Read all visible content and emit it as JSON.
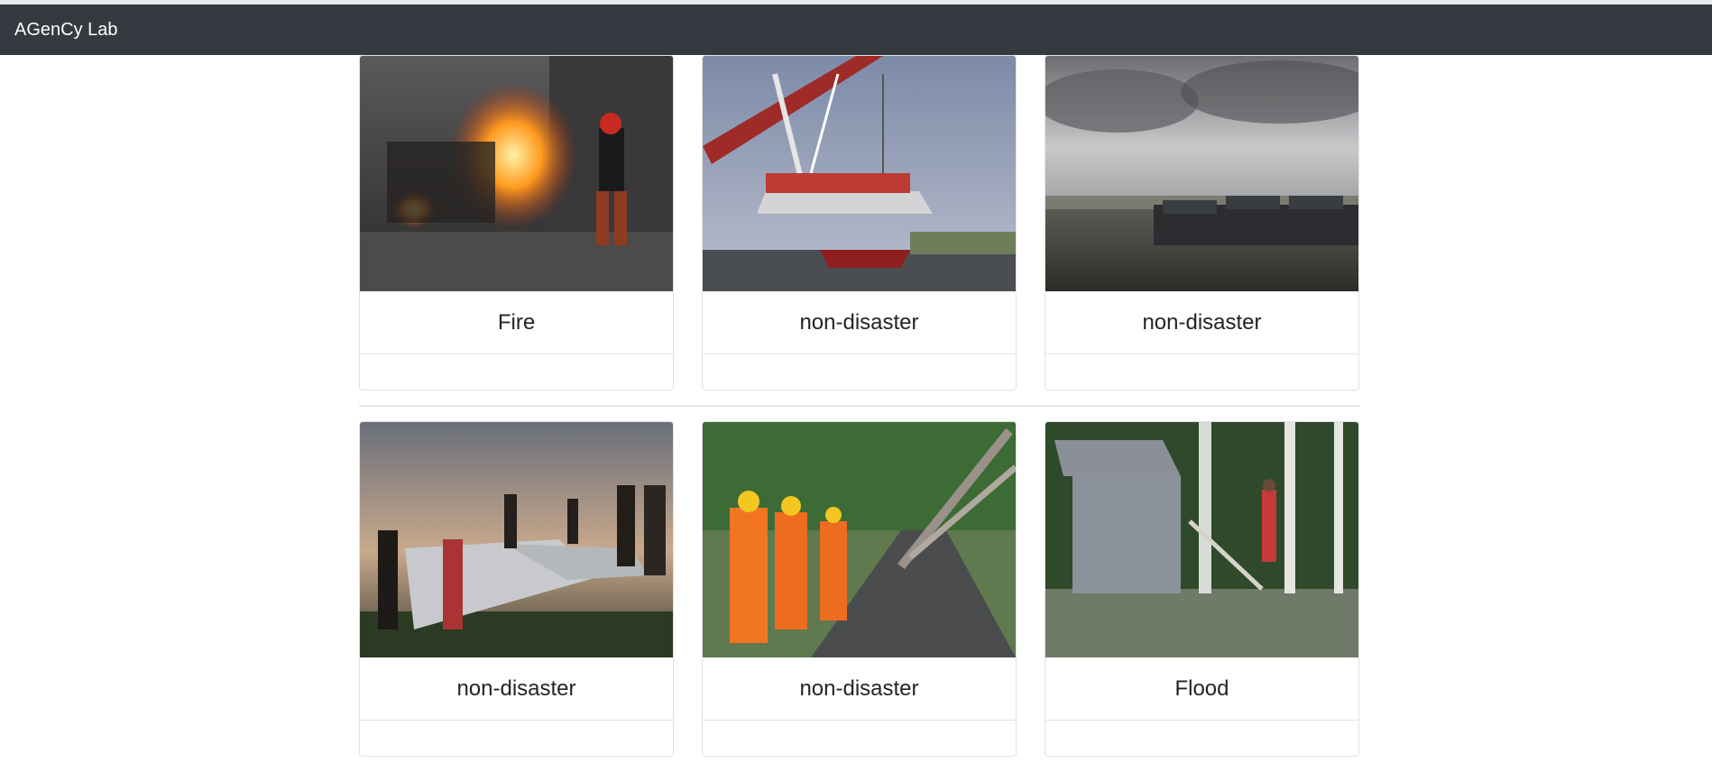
{
  "navbar": {
    "brand": "AGenCy Lab",
    "bg": "#343a40"
  },
  "gallery": {
    "cards": [
      {
        "label": "Fire",
        "image_icon": "fire-scene-image"
      },
      {
        "label": "non-disaster",
        "image_icon": "crane-lifting-boat-image"
      },
      {
        "label": "non-disaster",
        "image_icon": "cloudy-river-boats-image"
      },
      {
        "label": "non-disaster",
        "image_icon": "people-on-shore-image"
      },
      {
        "label": "non-disaster",
        "image_icon": "rescue-workers-fallen-tree-image"
      },
      {
        "label": "Flood",
        "image_icon": "flooded-house-image"
      }
    ]
  }
}
